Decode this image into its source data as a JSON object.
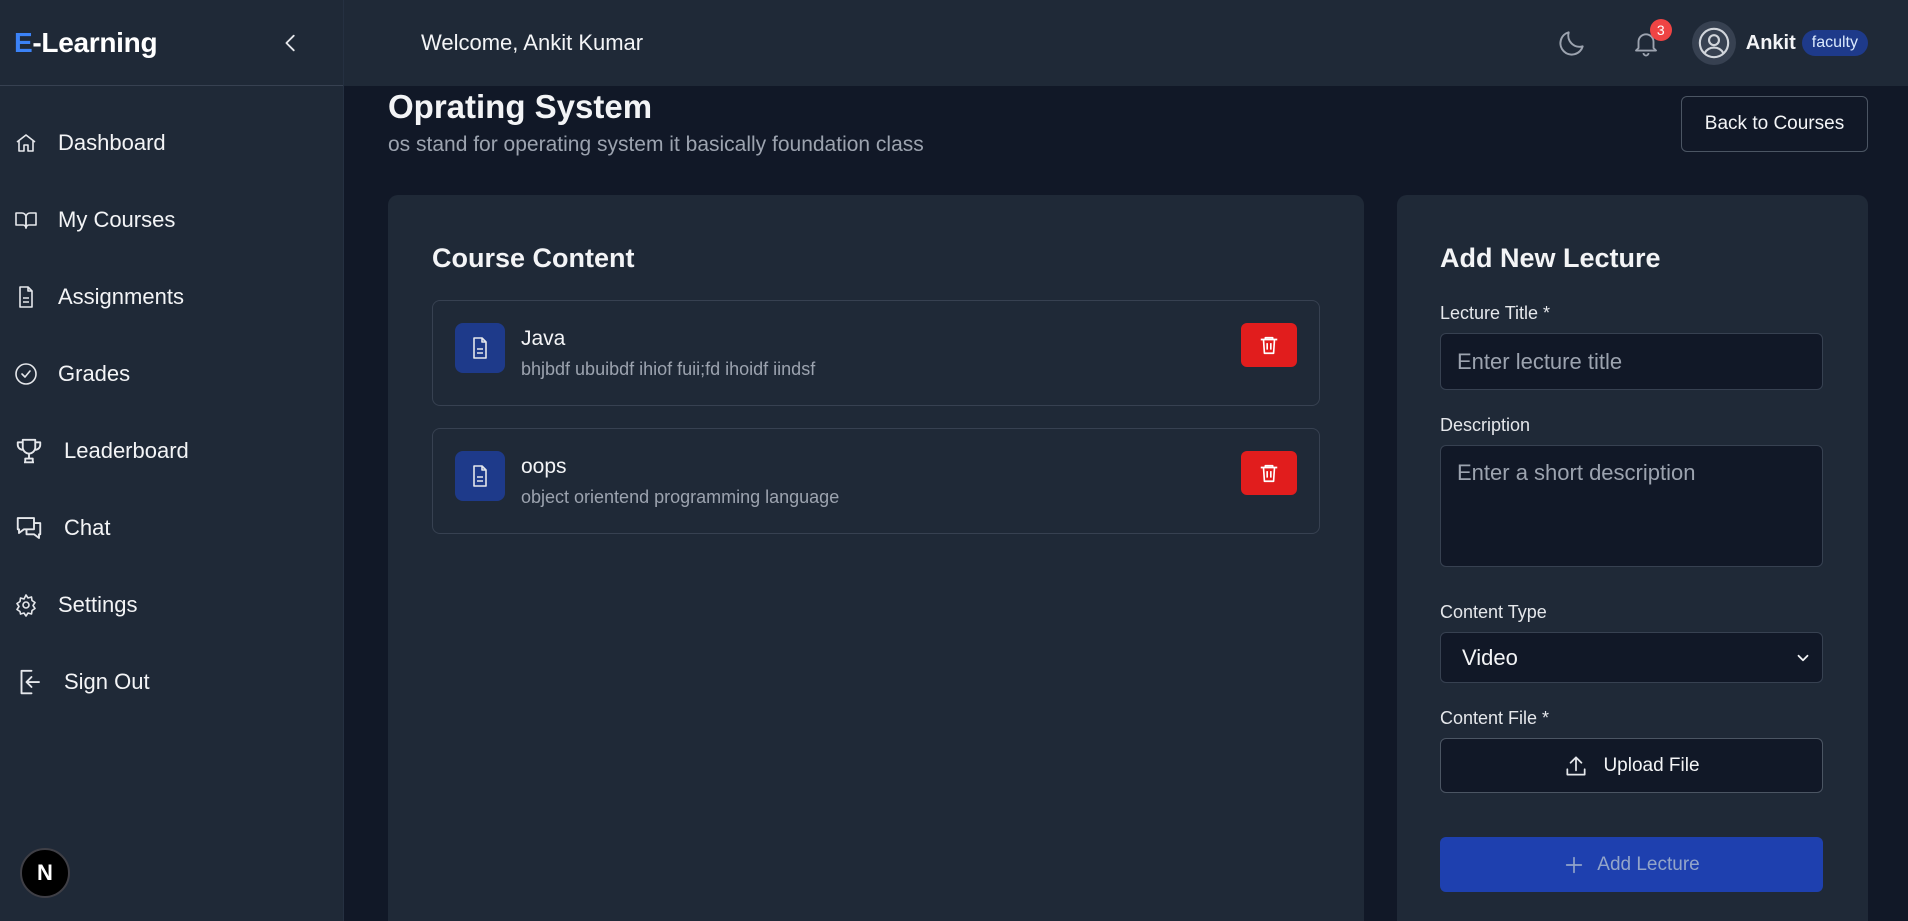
{
  "app": {
    "logo_first": "E",
    "logo_rest": "-Learning"
  },
  "sidebar": {
    "items": [
      {
        "label": "Dashboard",
        "icon": "home-icon"
      },
      {
        "label": "My Courses",
        "icon": "book-open-icon"
      },
      {
        "label": "Assignments",
        "icon": "file-icon"
      },
      {
        "label": "Grades",
        "icon": "check-circle-icon"
      },
      {
        "label": "Leaderboard",
        "icon": "trophy-icon"
      },
      {
        "label": "Chat",
        "icon": "chat-icon"
      },
      {
        "label": "Settings",
        "icon": "gear-icon"
      },
      {
        "label": "Sign Out",
        "icon": "sign-out-icon"
      }
    ],
    "badge_letter": "N"
  },
  "header": {
    "welcome": "Welcome, Ankit Kumar",
    "notification_count": "3",
    "user_name": "Ankit",
    "role": "faculty"
  },
  "course": {
    "title": "Oprating System",
    "subtitle": "os stand for operating system it basically foundation class",
    "back_label": "Back to Courses"
  },
  "content": {
    "title": "Course Content",
    "lectures": [
      {
        "title": "Java",
        "description": "bhjbdf ubuibdf ihiof fuii;fd ihoidf iindsf"
      },
      {
        "title": "oops",
        "description": "object orientend programming language"
      }
    ]
  },
  "form": {
    "title": "Add New Lecture",
    "lecture_title_label": "Lecture Title *",
    "lecture_title_placeholder": "Enter lecture title",
    "description_label": "Description",
    "description_placeholder": "Enter a short description",
    "content_type_label": "Content Type",
    "content_type_value": "Video",
    "content_file_label": "Content File *",
    "upload_label": "Upload File",
    "add_label": "Add Lecture"
  },
  "colors": {
    "background": "#111827",
    "panel": "#1f2937",
    "accent": "#3b82f6",
    "danger": "#e11d1d",
    "primary_button": "#1e40af"
  }
}
